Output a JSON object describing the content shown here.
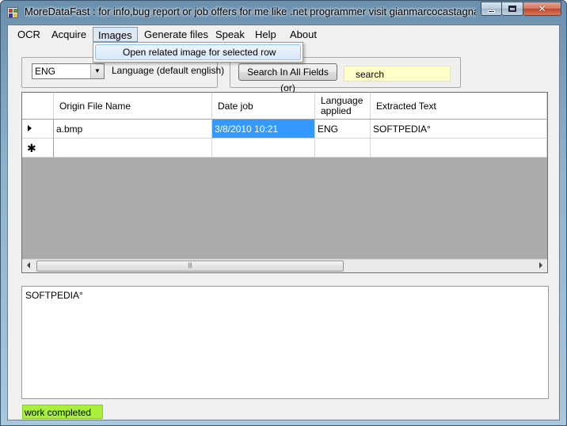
{
  "window": {
    "title": "MoreDataFast : for info,bug report or  job offers for me like .net programmer visit gianmarcocastagna.som..."
  },
  "menu": {
    "items": [
      "OCR",
      "Acquire",
      "Images",
      "Generate files",
      "Speak",
      "Help",
      "About"
    ],
    "open_item": "Images",
    "dropdown_item": "Open related image for selected row"
  },
  "language": {
    "selected": "ENG",
    "label": "Language (default english)"
  },
  "search": {
    "button_label": "Search In All Fields (or)",
    "value": "search"
  },
  "grid": {
    "columns": [
      "Origin File Name",
      "Date job",
      "Language applied",
      "Extracted Text"
    ],
    "rows": [
      {
        "file": "a.bmp",
        "date": "3/8/2010  10:21",
        "language": "ENG",
        "text": "SOFTPEDIA°"
      }
    ]
  },
  "output_text": "SOFTPEDIA°",
  "status": {
    "text": "work completed",
    "color": "#a9f03c"
  },
  "colors": {
    "selection": "#3399ff",
    "search_bg": "#ffffc8"
  }
}
